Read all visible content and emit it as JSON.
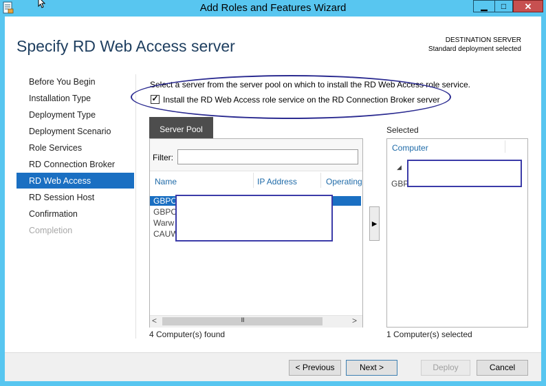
{
  "window": {
    "title": "Add Roles and Features Wizard",
    "minimize_glyph": "▁",
    "maximize_glyph": "□",
    "close_glyph": "✕"
  },
  "header": {
    "page_title": "Specify RD Web Access server",
    "destination_label": "DESTINATION SERVER",
    "destination_value": "Standard deployment selected"
  },
  "nav": {
    "items": [
      {
        "label": "Before You Begin",
        "state": "normal"
      },
      {
        "label": "Installation Type",
        "state": "normal"
      },
      {
        "label": "Deployment Type",
        "state": "normal"
      },
      {
        "label": "Deployment Scenario",
        "state": "normal"
      },
      {
        "label": "Role Services",
        "state": "normal"
      },
      {
        "label": "RD Connection Broker",
        "state": "normal"
      },
      {
        "label": "RD Web Access",
        "state": "selected"
      },
      {
        "label": "RD Session Host",
        "state": "normal"
      },
      {
        "label": "Confirmation",
        "state": "normal"
      },
      {
        "label": "Completion",
        "state": "disabled"
      }
    ]
  },
  "content": {
    "instruction": "Select a server from the server pool on which to install the RD Web Access role service.",
    "checkbox_label": "Install the RD Web Access role service on the RD Connection Broker server",
    "checkbox_mark": "✓",
    "checkbox_checked": true
  },
  "pool": {
    "tab_label": "Server Pool",
    "filter_label": "Filter:",
    "filter_value": "",
    "columns": [
      "Name",
      "IP Address",
      "Operating"
    ],
    "rows": [
      "GBPC",
      "GBPC",
      "Warw",
      "CAUW"
    ],
    "selected_row": 0,
    "scroll_left_glyph": "<",
    "scroll_right_glyph": ">",
    "scroll_grip": "III",
    "found_text": "4 Computer(s) found"
  },
  "add_button_glyph": "▶",
  "selected": {
    "label": "Selected",
    "column": "Computer",
    "expand_glyph": "◢",
    "items": [
      "GBPC"
    ],
    "count_text": "1 Computer(s) selected"
  },
  "footer": {
    "previous": "< Previous",
    "next": "Next >",
    "deploy": "Deploy",
    "cancel": "Cancel"
  },
  "colors": {
    "title_bar": "#58c6f0",
    "selection": "#1a6fc2",
    "page_title": "#1e3e5f",
    "close_button": "#c75050",
    "annotation": "#2a2a90"
  }
}
